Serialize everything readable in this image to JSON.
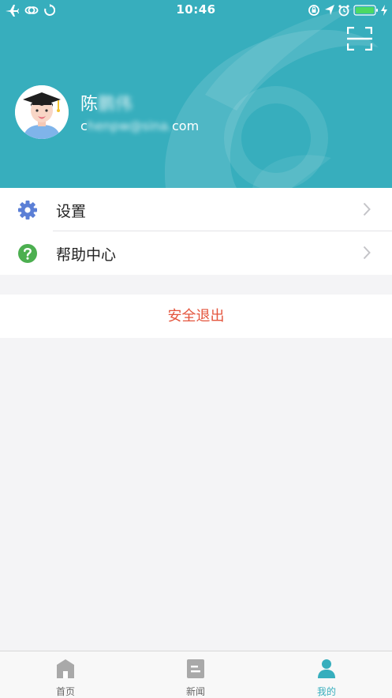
{
  "statusbar": {
    "time": "10:46",
    "left_icons": [
      "airplane-icon",
      "link-icon",
      "sync-icon"
    ],
    "right_icons": [
      "orientation-lock-icon",
      "location-icon",
      "alarm-icon",
      "battery-icon",
      "charging-icon"
    ]
  },
  "header": {
    "background_color": "#37aebd",
    "scan_icon": "scan-frame-icon"
  },
  "profile": {
    "avatar_icon": "graduate-avatar-icon",
    "name_visible": "陈",
    "name_blurred": "鹏伟",
    "email_prefix": "c",
    "email_blurred": "henpw@sina.",
    "email_suffix": "com"
  },
  "menu": {
    "items": [
      {
        "label": "设置",
        "icon": "gear-icon",
        "icon_color": "#5b7fd6"
      },
      {
        "label": "帮助中心",
        "icon": "help-icon",
        "icon_color": "#4caf50"
      }
    ]
  },
  "logout": {
    "label": "安全退出",
    "color": "#e4553d"
  },
  "tabbar": {
    "active_color": "#37aebd",
    "inactive_color": "#a9a9a9",
    "tabs": [
      {
        "label": "首页",
        "icon": "home-icon",
        "active": false
      },
      {
        "label": "新闻",
        "icon": "news-icon",
        "active": false
      },
      {
        "label": "我的",
        "icon": "profile-icon",
        "active": true
      }
    ]
  }
}
